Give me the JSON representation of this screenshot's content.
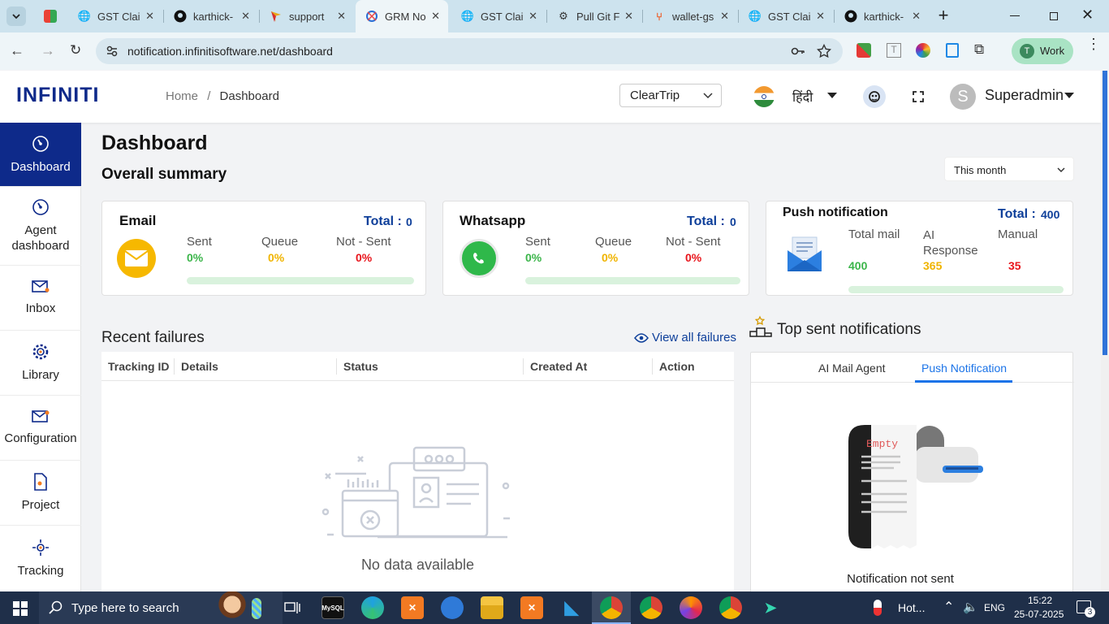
{
  "browser": {
    "tabs": [
      {
        "title": "",
        "icon": "tab-search-icon"
      },
      {
        "title": "GST Clai",
        "icon": "globe-icon"
      },
      {
        "title": "karthick-",
        "icon": "github-icon"
      },
      {
        "title": "support",
        "icon": "flag-icon"
      },
      {
        "title": "GRM No",
        "icon": "grm-icon"
      },
      {
        "title": "GST Clai",
        "icon": "globe-icon"
      },
      {
        "title": "Pull Git F",
        "icon": "openai-icon"
      },
      {
        "title": "wallet-gs",
        "icon": "git-icon"
      },
      {
        "title": "GST Clai",
        "icon": "globe-icon"
      },
      {
        "title": "karthick-",
        "icon": "github-icon"
      }
    ],
    "url": "notification.infinitisoftware.net/dashboard",
    "profile": "Work",
    "profile_initial": "T"
  },
  "header": {
    "logo": "INFINITI",
    "breadcrumb_home": "Home",
    "breadcrumb_sep": "/",
    "breadcrumb_current": "Dashboard",
    "client_select": "ClearTrip",
    "language": "हिंदी",
    "user_initial": "S",
    "user_name": "Superadmin"
  },
  "sidebar": {
    "items": [
      {
        "label": "Dashboard"
      },
      {
        "label": "Agent dashboard"
      },
      {
        "label": "Inbox"
      },
      {
        "label": "Library"
      },
      {
        "label": "Configuration"
      },
      {
        "label": "Project"
      },
      {
        "label": "Tracking"
      }
    ]
  },
  "main": {
    "title": "Dashboard",
    "subtitle": "Overall summary",
    "period_select": "This month",
    "cards": {
      "email": {
        "title": "Email",
        "total_label": "Total :",
        "total": "0",
        "sent_label": "Sent",
        "sent": "0%",
        "queue_label": "Queue",
        "queue": "0%",
        "notsent_label": "Not - Sent",
        "notsent": "0%"
      },
      "whatsapp": {
        "title": "Whatsapp",
        "total_label": "Total :",
        "total": "0",
        "sent_label": "Sent",
        "sent": "0%",
        "queue_label": "Queue",
        "queue": "0%",
        "notsent_label": "Not - Sent",
        "notsent": "0%"
      },
      "push": {
        "title": "Push notification",
        "total_label": "Total :",
        "total": "400",
        "mail_label": "Total mail",
        "mail": "400",
        "ai_label": "AI Response",
        "ai": "365",
        "manual_label": "Manual",
        "manual": "35"
      }
    },
    "failures": {
      "title": "Recent failures",
      "view_all": "View all failures",
      "columns": [
        "Tracking ID",
        "Details",
        "Status",
        "Created At",
        "Action"
      ],
      "empty": "No data available"
    },
    "top_sent": {
      "title": "Top sent notifications",
      "tabs": [
        "AI Mail Agent",
        "Push Notification"
      ],
      "active_tab": 1,
      "empty_badge": "Empty",
      "empty_text": "Notification not sent"
    }
  },
  "taskbar": {
    "search_placeholder": "Type here to search",
    "weather": "Hot...",
    "lang": "ENG",
    "time": "15:22",
    "date": "25-07-2025",
    "notif_count": "3"
  },
  "colors": {
    "primary": "#0e2a8a",
    "accent": "#1a73e8",
    "green": "#3bb54a",
    "amber": "#f0b400",
    "red": "#e8141b"
  }
}
